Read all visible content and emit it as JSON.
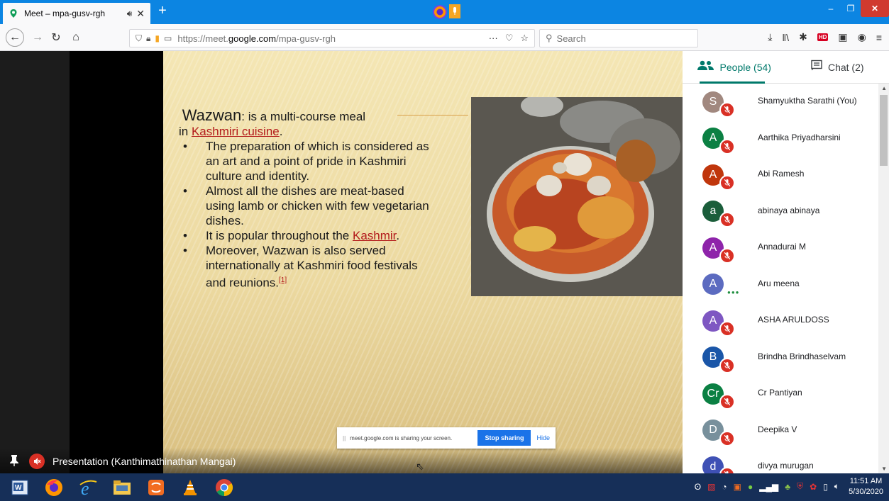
{
  "browser": {
    "tab_title": "Meet – mpa-gusv-rgh",
    "new_tab": "+",
    "url_plain": "https://meet.",
    "url_domain": "google.com",
    "url_path": "/mpa-gusv-rgh",
    "search_placeholder": "Search",
    "url_dots": "···",
    "tab_close": "✕",
    "window_close": "✕"
  },
  "slide": {
    "heading_word": "Wazwan",
    "heading_rest": ": is a multi-course meal",
    "line2_prefix": "in ",
    "line2_link": "Kashmiri cuisine",
    "line2_suffix": ".",
    "bullet1": "The preparation of which is considered as an art and a point of pride in Kashmiri culture and identity.",
    "bullet2": "Almost all the dishes are meat-based using lamb or chicken with few vegetarian dishes.",
    "bullet3_prefix": "It is popular throughout the ",
    "bullet3_link": "Kashmir",
    "bullet3_suffix": ".",
    "bullet4": "Moreover, Wazwan is also served internationally at Kashmiri food festivals and reunions.",
    "bullet4_ref": "[1]"
  },
  "share_bar": {
    "grip": "||",
    "message": "meet.google.com is sharing your screen.",
    "stop_label": "Stop sharing",
    "hide_label": "Hide"
  },
  "presentation_label": "Presentation (Kanthimathinathan Mangai)",
  "panel": {
    "people_tab": "People (54)",
    "chat_tab": "Chat (2)"
  },
  "participants": [
    {
      "initial": "S",
      "name": "Shamyuktha Sarathi (You)",
      "color": "#a1887f",
      "status": "muted"
    },
    {
      "initial": "A",
      "name": "Aarthika Priyadharsini",
      "color": "#0b8043",
      "status": "muted"
    },
    {
      "initial": "A",
      "name": "Abi Ramesh",
      "color": "#c0360c",
      "status": "muted"
    },
    {
      "initial": "a",
      "name": "abinaya abinaya",
      "color": "#1b5e3b",
      "status": "muted"
    },
    {
      "initial": "A",
      "name": "Annadurai M",
      "color": "#8e24aa",
      "status": "muted"
    },
    {
      "initial": "A",
      "name": "Aru meena",
      "color": "#5c6bc0",
      "status": "speaking"
    },
    {
      "initial": "A",
      "name": "ASHA ARULDOSS",
      "color": "#7e57c2",
      "status": "muted"
    },
    {
      "initial": "B",
      "name": "Brindha Brindhaselvam",
      "color": "#1a56a8",
      "status": "muted"
    },
    {
      "initial": "Cr",
      "name": "Cr Pantiyan",
      "color": "#0b8043",
      "status": "muted"
    },
    {
      "initial": "D",
      "name": "Deepika V",
      "color": "#78909c",
      "status": "muted"
    },
    {
      "initial": "d",
      "name": "divya murugan",
      "color": "#3f51b5",
      "status": "muted"
    }
  ],
  "clock": {
    "time": "11:51 AM",
    "date": "5/30/2020"
  },
  "colors": {
    "firefox_blue": "#0c85e2",
    "meet_teal": "#00796b",
    "mute_red": "#d93025",
    "stop_blue": "#1a73e8",
    "taskbar": "#162f58"
  }
}
